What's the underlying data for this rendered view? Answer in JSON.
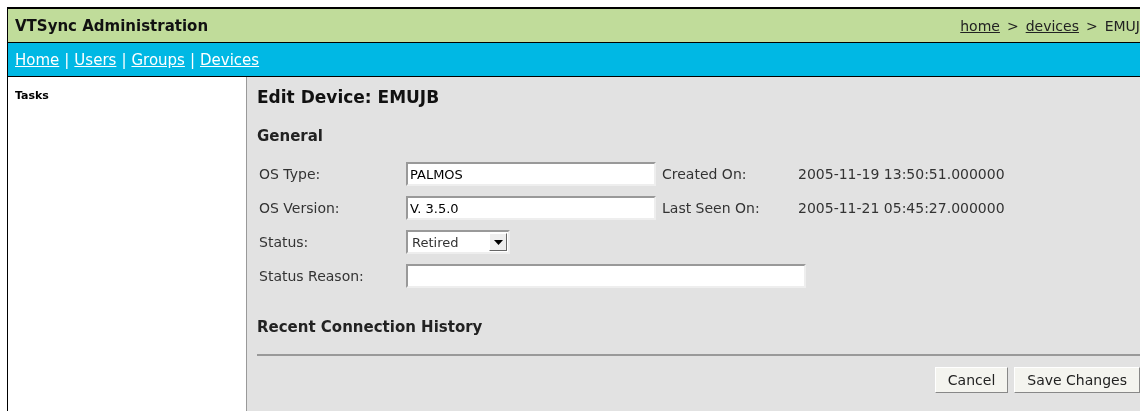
{
  "header": {
    "title": "VTSync Administration",
    "breadcrumb": [
      {
        "label": "home",
        "kind": "link"
      },
      {
        "label": ">",
        "kind": "separator"
      },
      {
        "label": "devices",
        "kind": "link"
      },
      {
        "label": ">",
        "kind": "separator"
      },
      {
        "label": "EMUJ",
        "kind": "current"
      }
    ]
  },
  "nav": [
    {
      "label": "Home",
      "kind": "link"
    },
    {
      "label": "|",
      "kind": "separator"
    },
    {
      "label": "Users",
      "kind": "link"
    },
    {
      "label": "|",
      "kind": "separator"
    },
    {
      "label": "Groups",
      "kind": "link"
    },
    {
      "label": "|",
      "kind": "separator"
    },
    {
      "label": "Devices",
      "kind": "link"
    }
  ],
  "sidebar": {
    "title": "Tasks"
  },
  "page_title": "Edit Device: EMUJB",
  "general": {
    "heading": "General",
    "fields": [
      {
        "label": "OS Type:",
        "kind": "text",
        "value": "PALMOS",
        "info_label": "Created On:",
        "info_value": "2005-11-19 13:50:51.000000"
      },
      {
        "label": "OS Version:",
        "kind": "text",
        "value": "V. 3.5.0",
        "info_label": "Last Seen On:",
        "info_value": "2005-11-21 05:45:27.000000"
      },
      {
        "label": "Status:",
        "kind": "select",
        "value": "Retired"
      },
      {
        "label": "Status Reason:",
        "kind": "wide"
      }
    ]
  },
  "history": {
    "heading": "Recent Connection History"
  },
  "buttons": [
    "Cancel",
    "Save Changes"
  ]
}
